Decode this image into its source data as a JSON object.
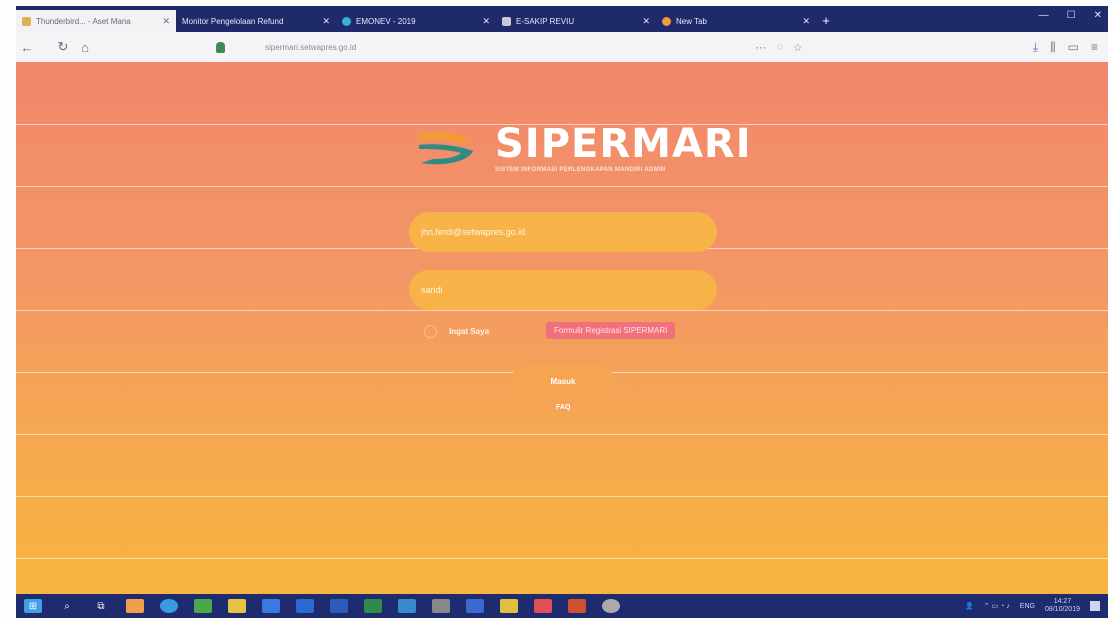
{
  "browser": {
    "tabs": [
      {
        "label": "Thunderbird... - Aset Mana",
        "color": "#e0b04a",
        "active": true
      },
      {
        "label": "Monitor Pengelolaan Refund",
        "color": "#3c4ea8",
        "active": false
      },
      {
        "label": "EMONEV - 2019",
        "color": "#3bb0d0",
        "active": false
      },
      {
        "label": "E-SAKIP REVIU",
        "color": "#c8c8d6",
        "active": false
      },
      {
        "label": "New Tab",
        "color": "#f09a3e",
        "active": false
      }
    ],
    "url": "sipermari.setwapres.go.id",
    "nav_back_icon": "back-arrow-icon",
    "nav_reload_icon": "reload-icon",
    "nav_home_icon": "home-icon"
  },
  "app": {
    "brand_name": "SIPERMARI",
    "tagline": "SISTEM INFORMASI PERLENGKAPAN MANDIRI ADMIN",
    "logo_colors": {
      "top": "#f39a35",
      "bottom": "#2f8c84"
    }
  },
  "login": {
    "email_placeholder": "jhn.ferdi@setwapres.go.id",
    "password_placeholder": "sandi",
    "remember_label": "Ingat Saya",
    "register_link": "Formulir Registrasi SIPERMARI",
    "submit_label": "Masuk",
    "help_label": "FAQ"
  },
  "taskbar": {
    "apps": [
      {
        "icon": "windows-start-icon",
        "color": "#3fa0e8"
      },
      {
        "icon": "search-icon",
        "color": "#1e2b6e"
      },
      {
        "icon": "task-view-icon",
        "color": "#1e2b6e"
      },
      {
        "icon": "firefox-icon",
        "color": "#f0a04a"
      },
      {
        "icon": "edge-icon",
        "color": "#3a9ae0"
      },
      {
        "icon": "chrome-icon",
        "color": "#4aa84a"
      },
      {
        "icon": "file-explorer-icon",
        "color": "#e6c245"
      },
      {
        "icon": "store-icon",
        "color": "#3a7ae0"
      },
      {
        "icon": "outlook-icon",
        "color": "#2a6ad0"
      },
      {
        "icon": "word-icon",
        "color": "#2b5db8"
      },
      {
        "icon": "excel-icon",
        "color": "#2e8b4a"
      },
      {
        "icon": "photos-icon",
        "color": "#3a8ad0"
      },
      {
        "icon": "calculator-icon",
        "color": "#888"
      },
      {
        "icon": "mail-icon",
        "color": "#3a6ad0"
      },
      {
        "icon": "notes-icon",
        "color": "#e0c040"
      },
      {
        "icon": "paint-icon",
        "color": "#e05050"
      },
      {
        "icon": "powerpoint-icon",
        "color": "#d05030"
      },
      {
        "icon": "settings-icon",
        "color": "#aaa"
      }
    ],
    "lang": "ENG",
    "time": "14:27",
    "date": "08/10/2019"
  }
}
